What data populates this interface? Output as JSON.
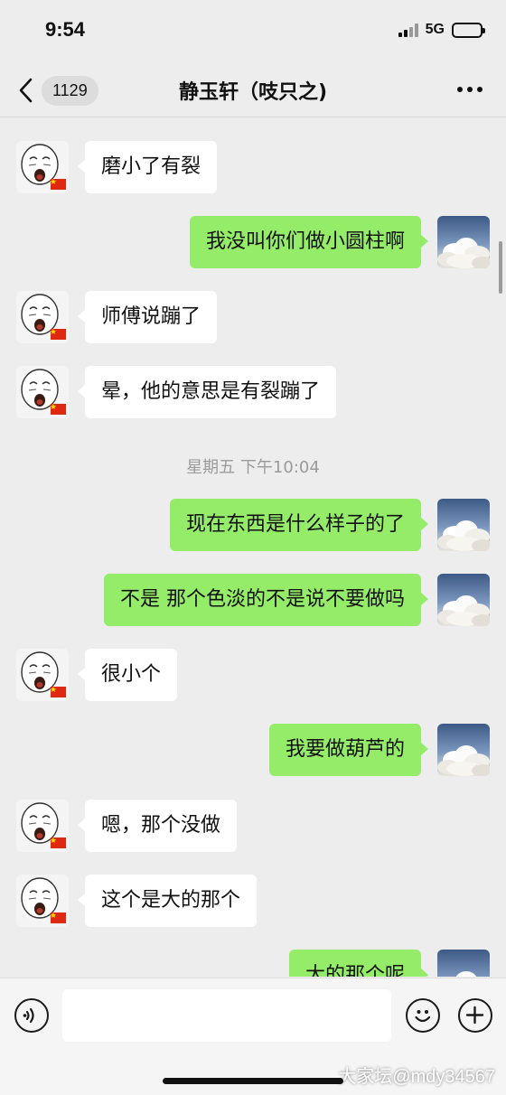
{
  "status_bar": {
    "time": "9:54",
    "network": "5G"
  },
  "nav": {
    "unread_count": "1129",
    "title": "静玉轩（吱只之)"
  },
  "messages": [
    {
      "side": "in",
      "text": "磨小了有裂"
    },
    {
      "side": "out",
      "text": "我没叫你们做小圆柱啊"
    },
    {
      "side": "in",
      "text": "师傅说蹦了"
    },
    {
      "side": "in",
      "text": "晕，他的意思是有裂蹦了"
    },
    {
      "side": "out",
      "text": "现在东西是什么样子的了"
    },
    {
      "side": "out",
      "text": "不是 那个色淡的不是说不要做吗"
    },
    {
      "side": "in",
      "text": "很小个"
    },
    {
      "side": "out",
      "text": "我要做葫芦的"
    },
    {
      "side": "in",
      "text": "嗯，那个没做"
    },
    {
      "side": "in",
      "text": "这个是大的那个"
    },
    {
      "side": "out",
      "text": "大的那个呢"
    }
  ],
  "timestamp": "星期五 下午10:04",
  "input": {
    "placeholder": ""
  },
  "watermark": "大家坛@mdy34567",
  "colors": {
    "background": "#ededed",
    "outgoing_bubble": "#95ec69",
    "incoming_bubble": "#ffffff"
  },
  "icons": {
    "back": "chevron-left-icon",
    "more": "more-dots-icon",
    "voice": "voice-icon",
    "emoji": "emoji-icon",
    "plus": "plus-icon"
  }
}
